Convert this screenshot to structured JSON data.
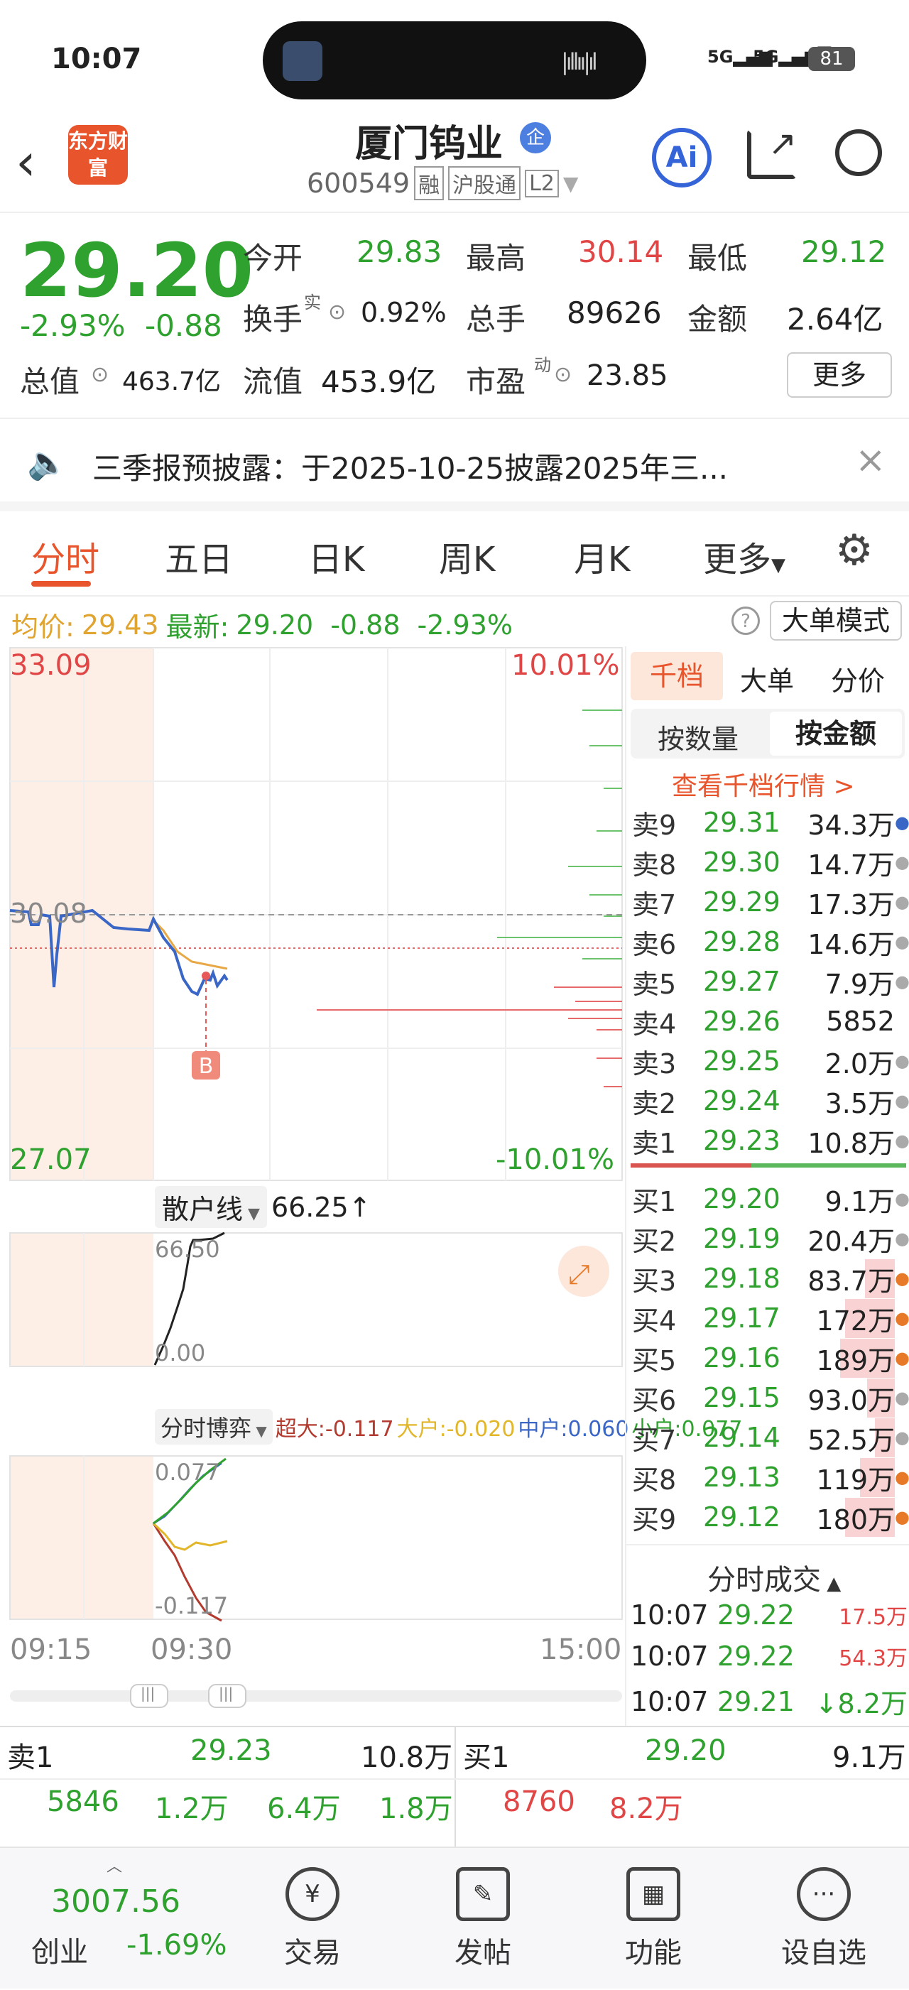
{
  "status": {
    "time": "10:07",
    "battery": "81",
    "net1": "5G",
    "net2": "5G"
  },
  "header": {
    "logo": "东方财富",
    "title": "厦门钨业",
    "badge": "企",
    "code": "600549",
    "tag1": "融",
    "tag2": "沪股通",
    "tag3": "L2"
  },
  "quote": {
    "price": "29.20",
    "pct": "-2.93%",
    "chg": "-0.88",
    "open_label": "今开",
    "open": "29.83",
    "high_label": "最高",
    "high": "30.14",
    "low_label": "最低",
    "low": "29.12",
    "turn_label": "换手",
    "turn_sup": "实",
    "turn": "0.92%",
    "vol_label": "总手",
    "vol": "89626",
    "amt_label": "金额",
    "amt": "2.64亿",
    "cap_label": "总值",
    "cap": "463.7亿",
    "float_label": "流值",
    "float": "453.9亿",
    "pe_label": "市盈",
    "pe_sup": "动",
    "pe": "23.85",
    "more": "更多"
  },
  "notice": {
    "text": "三季报预披露：于2025-10-25披露2025年三..."
  },
  "tabs": [
    "分时",
    "五日",
    "日K",
    "周K",
    "月K",
    "更多"
  ],
  "avgline": {
    "avg_label": "均价:",
    "avg": "29.43",
    "new_label": "最新:",
    "new": "29.20",
    "chg": "-0.88",
    "pct": "-2.93%",
    "mode": "大单模式"
  },
  "chart": {
    "top_price": "33.09",
    "top_pct": "10.01%",
    "bot_price": "27.07",
    "bot_pct": "-10.01%",
    "mid": "30.08",
    "marker": "B",
    "retail_label": "散户线",
    "retail_val": "66.25↑",
    "retail_top": "66.50",
    "retail_bot": "0.00",
    "game_label": "分时博弈",
    "game_super": "超大:-0.117",
    "game_big": "大户:-0.020",
    "game_mid": "中户:0.060",
    "game_small": "小户:0.077",
    "game_top": "0.077",
    "game_bot": "-0.117",
    "t_start": "09:15",
    "t_open": "09:30",
    "t_end": "15:00"
  },
  "book": {
    "tabs": [
      "千档",
      "大单",
      "分价"
    ],
    "sub": [
      "按数量",
      "按金额"
    ],
    "link": "查看千档行情 >",
    "asks": [
      {
        "l": "卖9",
        "p": "29.31",
        "v": "34.3万"
      },
      {
        "l": "卖8",
        "p": "29.30",
        "v": "14.7万"
      },
      {
        "l": "卖7",
        "p": "29.29",
        "v": "17.3万"
      },
      {
        "l": "卖6",
        "p": "29.28",
        "v": "14.6万"
      },
      {
        "l": "卖5",
        "p": "29.27",
        "v": "7.9万"
      },
      {
        "l": "卖4",
        "p": "29.26",
        "v": "5852"
      },
      {
        "l": "卖3",
        "p": "29.25",
        "v": "2.0万"
      },
      {
        "l": "卖2",
        "p": "29.24",
        "v": "3.5万"
      },
      {
        "l": "卖1",
        "p": "29.23",
        "v": "10.8万"
      }
    ],
    "bids": [
      {
        "l": "买1",
        "p": "29.20",
        "v": "9.1万"
      },
      {
        "l": "买2",
        "p": "29.19",
        "v": "20.4万"
      },
      {
        "l": "买3",
        "p": "29.18",
        "v": "83.7万"
      },
      {
        "l": "买4",
        "p": "29.17",
        "v": "172万"
      },
      {
        "l": "买5",
        "p": "29.16",
        "v": "189万"
      },
      {
        "l": "买6",
        "p": "29.15",
        "v": "93.0万"
      },
      {
        "l": "买7",
        "p": "29.14",
        "v": "52.5万"
      },
      {
        "l": "买8",
        "p": "29.13",
        "v": "119万"
      },
      {
        "l": "买9",
        "p": "29.12",
        "v": "180万"
      }
    ],
    "ticks_title": "分时成交",
    "ticks": [
      {
        "t": "10:07",
        "p": "29.22",
        "v": "17.5万"
      },
      {
        "t": "10:07",
        "p": "29.22",
        "v": "54.3万"
      },
      {
        "t": "10:07",
        "p": "29.21",
        "v": "↓8.2万"
      }
    ]
  },
  "bottom": {
    "ask_label": "卖1",
    "ask_price": "29.23",
    "ask_vol": "10.8万",
    "bid_label": "买1",
    "bid_price": "29.20",
    "bid_vol": "9.1万",
    "q1": "5846",
    "q2": "1.2万",
    "q3": "6.4万",
    "q4": "1.8万",
    "q5": "8760",
    "q6": "8.2万"
  },
  "nav": {
    "index_val": "3007.56",
    "index_name": "创业",
    "index_pct": "-1.69%",
    "items": [
      "交易",
      "发帖",
      "功能",
      "设自选"
    ]
  }
}
